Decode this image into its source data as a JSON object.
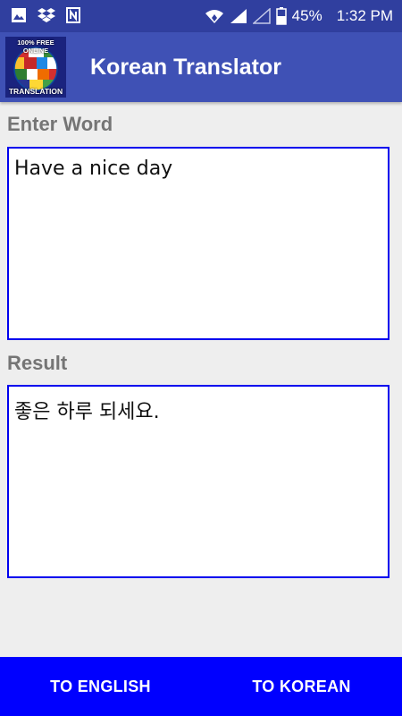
{
  "status_bar": {
    "battery_percent": "45%",
    "time": "1:32 PM",
    "left_icons": [
      "image-icon",
      "dropbox-icon",
      "notification-n-icon"
    ],
    "right_icons": [
      "wifi-icon",
      "signal-icon",
      "signal-empty-icon",
      "battery-icon"
    ]
  },
  "app_bar": {
    "title": "Korean Translator",
    "logo_top_text": "100% FREE ONLINE",
    "logo_bottom_text": "TRANSLATION"
  },
  "input_section": {
    "label": "Enter Word",
    "value": "Have a nice day"
  },
  "result_section": {
    "label": "Result",
    "value": "좋은 하루 되세요."
  },
  "bottom_bar": {
    "to_english_label": "TO ENGLISH",
    "to_korean_label": "TO KOREAN"
  },
  "colors": {
    "status_bar": "#303f9f",
    "app_bar": "#3f51b5",
    "box_border": "#0000ee",
    "bottom_bar": "#0000ff",
    "label": "#757575",
    "background": "#eeeeee"
  }
}
